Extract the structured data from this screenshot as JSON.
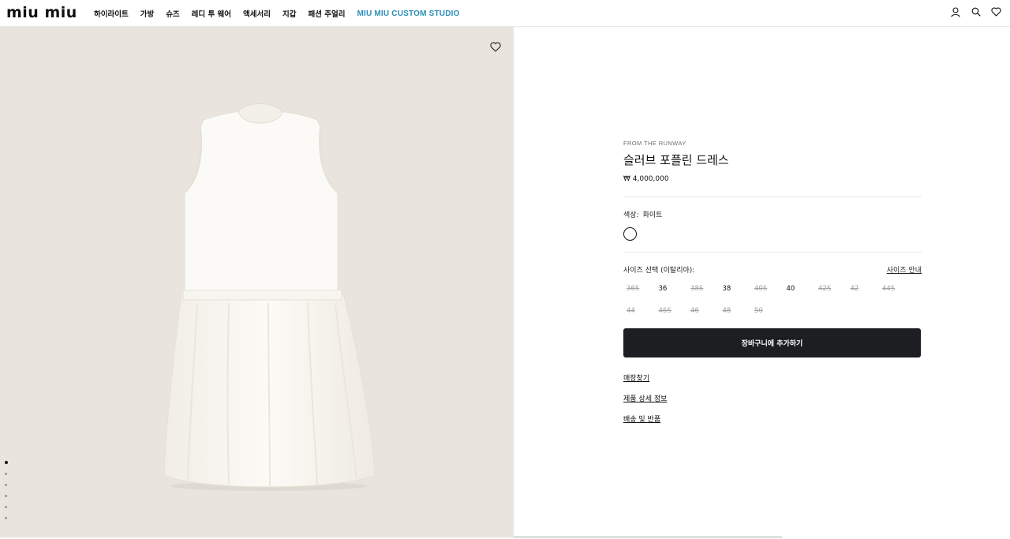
{
  "header": {
    "logo": "miu miu",
    "nav": [
      {
        "label": "하이라이트"
      },
      {
        "label": "가방"
      },
      {
        "label": "슈즈"
      },
      {
        "label": "레디 투 웨어"
      },
      {
        "label": "액세서리"
      },
      {
        "label": "지갑"
      },
      {
        "label": "패션 주얼리"
      },
      {
        "label": "MIU MIU CUSTOM STUDIO"
      }
    ],
    "icons": [
      "user-icon",
      "search-icon",
      "heart-icon"
    ]
  },
  "gallery": {
    "background": "#e9e4dd",
    "fav_icon": "heart-icon",
    "image_count": 6,
    "active_index": 0
  },
  "product": {
    "eyebrow": "FROM THE RUNWAY",
    "title": "슬러브 포플린 드레스",
    "price": "₩ 4,000,000",
    "color_label": "색상:",
    "color_value": "화이트",
    "size_label": "사이즈 선택 (이탈리아):",
    "size_guide": "사이즈 안내",
    "sizes": [
      {
        "label": "36S",
        "available": false
      },
      {
        "label": "36",
        "available": true
      },
      {
        "label": "38S",
        "available": false
      },
      {
        "label": "38",
        "available": true
      },
      {
        "label": "40S",
        "available": false
      },
      {
        "label": "40",
        "available": true
      },
      {
        "label": "42S",
        "available": false
      },
      {
        "label": "42",
        "available": false
      },
      {
        "label": "44S",
        "available": false
      },
      {
        "label": "44",
        "available": false
      },
      {
        "label": "46S",
        "available": false
      },
      {
        "label": "46",
        "available": false
      },
      {
        "label": "48",
        "available": false
      },
      {
        "label": "50",
        "available": false
      }
    ],
    "cart_button": "장바구니에 추가하기",
    "links": [
      "매장찾기",
      "제품 상세 정보",
      "배송 및 반품"
    ]
  }
}
